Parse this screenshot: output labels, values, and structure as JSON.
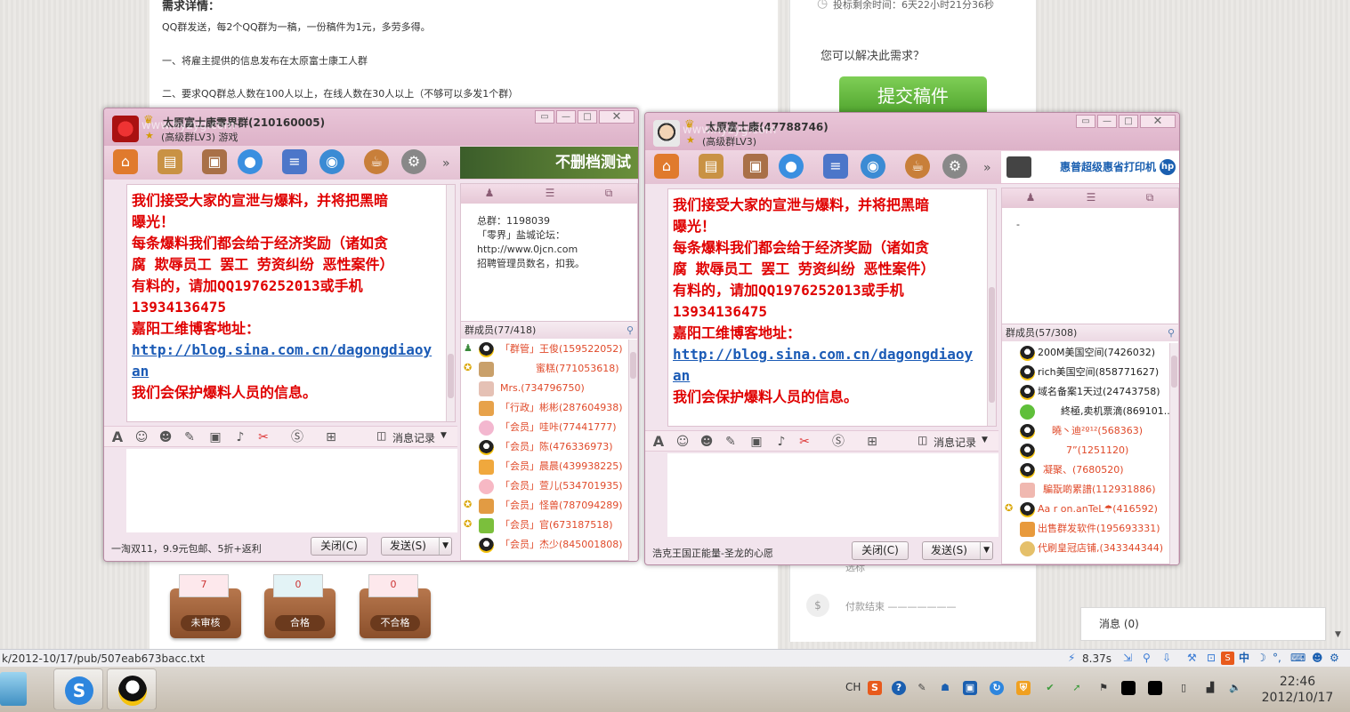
{
  "page": {
    "heading": "需求详情：",
    "lines": [
      "QQ群发送，每2个QQ群为一稿，一份稿件为1元，多劳多得。",
      "一、将雇主提供的信息发布在太原富士康工人群",
      "二、要求QQ群总人数在100人以上，在线人数在30人以上（不够可以多发1个群）"
    ],
    "deadline": "投标剩余时间：6天22小时21分36秒",
    "question": "您可以解决此需求？",
    "submit_label": "提交稿件",
    "step_label": "选标",
    "step_pay": "付款结束 ———————",
    "boxes": [
      {
        "count": "7",
        "label": "未审核"
      },
      {
        "count": "0",
        "label": "合格"
      },
      {
        "count": "0",
        "label": "不合格"
      }
    ],
    "message_tab": "消息 (0)",
    "status_url": "k/2012-10/17/pub/507eab673bacc.txt",
    "speed": "8.37s"
  },
  "left_window": {
    "title": "太原富士康零界群(210160005)",
    "subtitle": "(高级群LV3) 游戏",
    "watermark": "www.hyzyg.com",
    "ad_text": "不删档测试",
    "msg_lines": [
      "我们接受大家的宣泄与爆料，并将把黑暗",
      "曝光！",
      "每条爆料我们都会给于经济奖励（诸如贪",
      "腐 欺辱员工 罢工 劳资纠纷 恶性案件）",
      "有料的，请加QQ1976252013或手机",
      "13934136475",
      "嘉阳工维博客地址："
    ],
    "link1": "http://blog.sina.com.cn/dagongdiaoy",
    "link2": "an",
    "msg_last": "我们会保护爆料人员的信息。",
    "notice_lines": [
      "总群：1198039",
      "「零界」盐城论坛：",
      "http://www.0jcn.com",
      "招聘管理员数名，扣我。"
    ],
    "members_header": "群成员(77/418)",
    "members": [
      "「群管」王俊(159522052)",
      "蜜糕(771053618)",
      "Mrs.(734796750)",
      "「行政」彬彬(287604938)",
      "「会员」哇咔(77441777)",
      "「会员」陈(476336973)",
      "「会员」晨晨(439938225)",
      "「会员」萱儿(534701935)",
      "「会员」怪兽(787094289)",
      "「会员」官(673187518)",
      "「会员」杰少(845001808)"
    ],
    "history_label": "消息记录",
    "footer_text": "一淘双11，9.9元包邮、5折+返利",
    "close_label": "关闭(C)",
    "send_label": "发送(S)"
  },
  "right_window": {
    "title": "太原富士康(47788746)",
    "subtitle": "(高级群LV3)",
    "watermark": "www.hyzyg.com",
    "ad_text": "惠普超级惠省打印机",
    "msg_lines": [
      "我们接受大家的宣泄与爆料，并将把黑暗",
      "曝光！",
      "每条爆料我们都会给于经济奖励（诸如贪",
      "腐 欺辱员工 罢工 劳资纠纷 恶性案件）",
      "有料的，请加QQ1976252013或手机",
      "13934136475",
      "嘉阳工维博客地址："
    ],
    "link1": "http://blog.sina.com.cn/dagongdiaoy",
    "link2": "an",
    "msg_last": "我们会保护爆料人员的信息。",
    "notice_lines": [
      "-"
    ],
    "members_header": "群成员(57/308)",
    "members": [
      "200M美国空间(7426032)",
      "rich美国空间(858771627)",
      "域名备案1天过(24743758)",
      "終極,卖机票滴(869101...",
      "曉丶迪²º¹²(568363)",
      "7”(1251120)",
      "凝聚、(7680520)",
      "騙翫啲累譜(112931886)",
      "Aa r on.anTeL☂(416592)",
      "出售群发软件(195693331)",
      "代刷皇冠店铺,(343344344)"
    ],
    "history_label": "消息记录",
    "footer_text": "浩克王国正能量-圣龙的心愿",
    "close_label": "关闭(C)",
    "send_label": "发送(S)"
  },
  "tray": {
    "lang": "CH",
    "time": "22:46",
    "date": "2012/10/17"
  },
  "colors": {
    "msg": "#e00000",
    "link": "#1b5bb6",
    "submit": "#5fb43a",
    "window_border": "#b78aa3"
  }
}
